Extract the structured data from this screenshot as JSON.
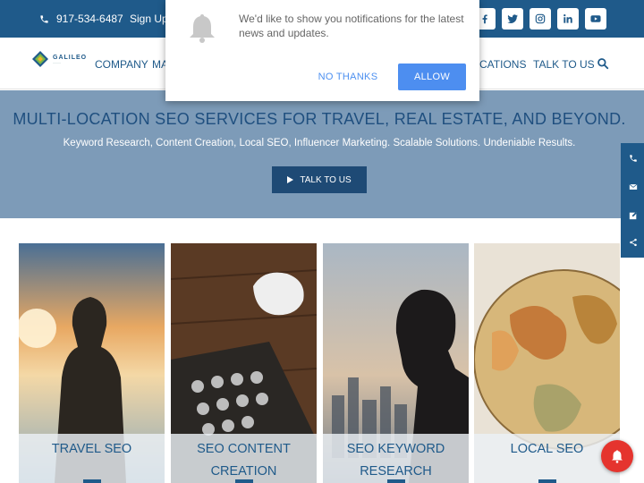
{
  "topbar": {
    "phone": "917-534-6487",
    "signup": "Sign Up",
    "socials": [
      "facebook-icon",
      "twitter-icon",
      "instagram-icon",
      "linkedin-icon",
      "youtube-icon"
    ]
  },
  "header": {
    "logo_text": "GALILEO",
    "nav": {
      "company": "COMPANY",
      "partial_left": "MA",
      "partial_right": "CATIONS",
      "talk": "TALK TO US"
    }
  },
  "hero": {
    "title": "MULTI-LOCATION SEO SERVICES FOR TRAVEL, REAL ESTATE, AND BEYOND.",
    "subtitle": "Keyword Research, Content Creation, Local SEO, Influencer Marketing. Scalable Solutions. Undeniable Results.",
    "button": "TALK TO US"
  },
  "cards": [
    {
      "title": "TRAVEL SEO"
    },
    {
      "title": "SEO CONTENT CREATION"
    },
    {
      "title": "SEO KEYWORD RESEARCH"
    },
    {
      "title": "LOCAL SEO"
    }
  ],
  "notification": {
    "message": "We'd like to show you notifications for the latest news and updates.",
    "no_thanks": "NO THANKS",
    "allow": "ALLOW"
  },
  "colors": {
    "brand": "#1f5a8a",
    "hero_bg": "#7d9bb8",
    "allow_blue": "#4d8ef0",
    "bubble_red": "#e5342e"
  }
}
